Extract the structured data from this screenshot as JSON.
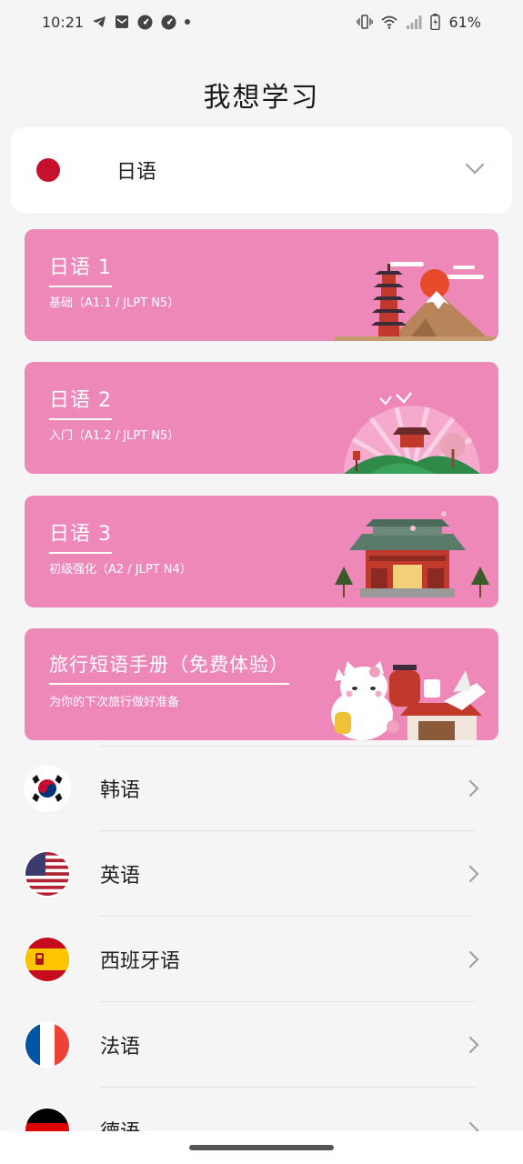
{
  "status_bar": {
    "time": "10:21",
    "battery": "61%",
    "icons": [
      "telegram-icon",
      "mail-icon",
      "speed-icon",
      "speed-icon",
      "dot-icon",
      "vibrate-icon",
      "wifi-icon",
      "signal-icon",
      "battery-icon"
    ]
  },
  "page": {
    "title": "我想学习"
  },
  "selected_language": {
    "name": "日语",
    "flag": "japan-flag-icon",
    "expand_icon": "chevron-down-icon"
  },
  "courses": [
    {
      "title": "日语 1",
      "subtitle": "基础（A1.1 / JLPT N5）",
      "art": "pagoda-fuji-art"
    },
    {
      "title": "日语 2",
      "subtitle": "入门（A1.2 / JLPT N5）",
      "art": "fan-shrine-art"
    },
    {
      "title": "日语 3",
      "subtitle": "初级强化（A2 / JLPT N4）",
      "art": "temple-art"
    },
    {
      "title": "旅行短语手册（免费体验）",
      "subtitle": "为你的下次旅行做好准备",
      "art": "lucky-cat-art"
    }
  ],
  "colors": {
    "course_card": "#ee88b8",
    "background": "#f5f5f5",
    "chevron": "#9aa3ad"
  },
  "languages": [
    {
      "name": "韩语",
      "flag": "korea-flag-icon"
    },
    {
      "name": "英语",
      "flag": "usa-flag-icon"
    },
    {
      "name": "西班牙语",
      "flag": "spain-flag-icon"
    },
    {
      "name": "法语",
      "flag": "france-flag-icon"
    },
    {
      "name": "德语",
      "flag": "germany-flag-icon"
    }
  ]
}
